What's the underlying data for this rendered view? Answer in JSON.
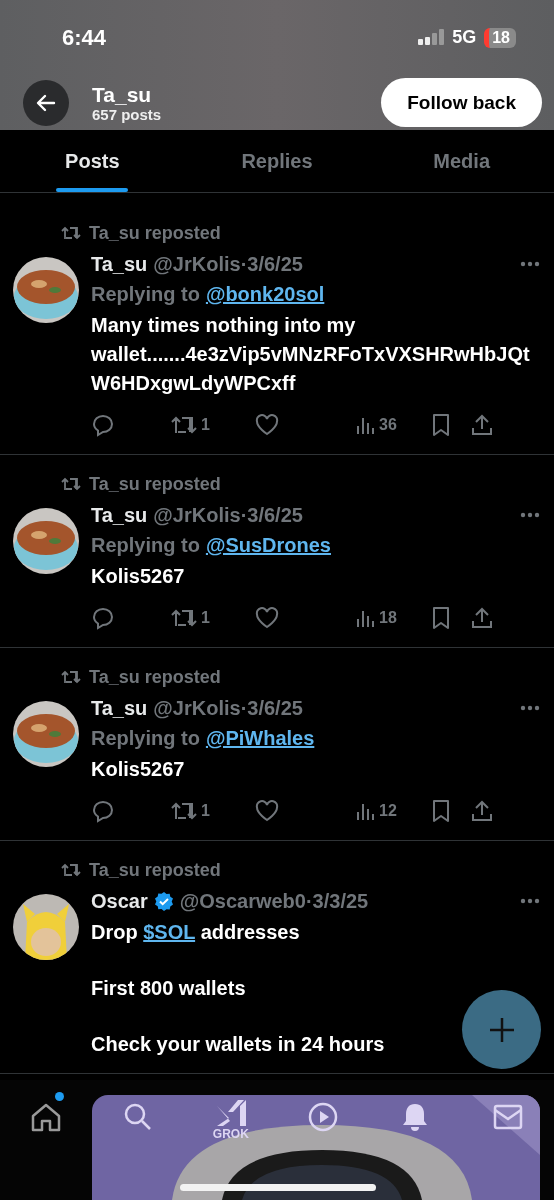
{
  "status_bar": {
    "time": "6:44",
    "network": "5G",
    "battery": "18"
  },
  "header": {
    "title": "Ta_su",
    "subtitle": "657 posts",
    "button": "Follow back"
  },
  "tabs": [
    {
      "label": "Posts",
      "selected": true
    },
    {
      "label": "Replies",
      "selected": false
    },
    {
      "label": "Media",
      "selected": false
    }
  ],
  "posts": [
    {
      "repost": "Ta_su reposted",
      "name": "Ta_su",
      "verified": false,
      "handle_date": "@JrKolis·3/6/25",
      "reply_prefix": "Replying to",
      "reply_to": "@bonk20sol",
      "paragraphs": [
        [
          {
            "kind": "plain",
            "text": "Many times nothing into my wallet.......4e3zVip5vMNzRFoTxVXSHRwHbJQtW6HDxgwLdyWPCxff"
          }
        ]
      ],
      "retweets": "1",
      "views": "36"
    },
    {
      "repost": "Ta_su reposted",
      "name": "Ta_su",
      "verified": false,
      "handle_date": "@JrKolis·3/6/25",
      "reply_prefix": "Replying to",
      "reply_to": "@SusDrones",
      "paragraphs": [
        [
          {
            "kind": "plain",
            "text": "Kolis5267"
          }
        ]
      ],
      "retweets": "1",
      "views": "18"
    },
    {
      "repost": "Ta_su reposted",
      "name": "Ta_su",
      "verified": false,
      "handle_date": "@JrKolis·3/6/25",
      "reply_prefix": "Replying to",
      "reply_to": "@PiWhales",
      "paragraphs": [
        [
          {
            "kind": "plain",
            "text": "Kolis5267"
          }
        ]
      ],
      "retweets": "1",
      "views": "12"
    },
    {
      "repost": "Ta_su reposted",
      "name": "Oscar",
      "verified": true,
      "handle_date": "@Oscarweb0·3/3/25",
      "paragraphs": [
        [
          {
            "kind": "plain",
            "text": "Drop "
          },
          {
            "kind": "link",
            "text": "$SOL"
          },
          {
            "kind": "plain",
            "text": " addresses"
          }
        ],
        [
          {
            "kind": "plain",
            "text": "First 800 wallets"
          }
        ],
        [
          {
            "kind": "plain",
            "text": "Check your wallets in 24 hours"
          }
        ]
      ]
    }
  ],
  "nav": [
    {
      "kind": "home",
      "badge": true
    },
    {
      "kind": "search",
      "badge": false
    },
    {
      "kind": "grok",
      "label": "GROK",
      "badge": false
    },
    {
      "kind": "play",
      "badge": false
    },
    {
      "kind": "bell",
      "badge": false
    },
    {
      "kind": "mail",
      "badge": false
    }
  ]
}
